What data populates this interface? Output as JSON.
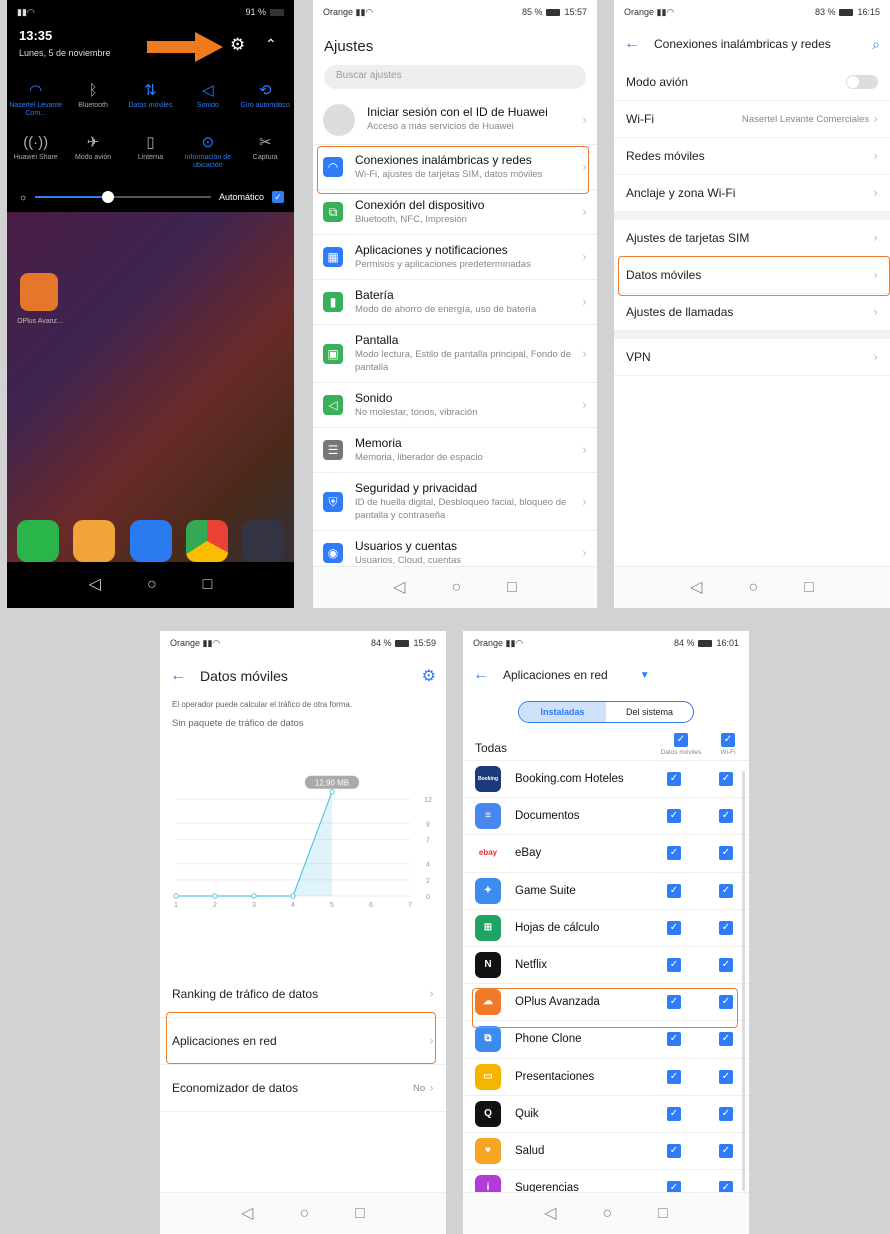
{
  "p1": {
    "status_right": "91 %",
    "time": "13:35",
    "date": "Lunes, 5 de noviembre",
    "tiles_row1": [
      {
        "icon": "wifi-icon",
        "glyph": "◠",
        "label": "Nasertel Levante Com...",
        "on": true
      },
      {
        "icon": "bluetooth-icon",
        "glyph": "ᛒ",
        "label": "Bluetooth",
        "on": false
      },
      {
        "icon": "mobile-data-icon",
        "glyph": "⇅",
        "label": "Datos móviles",
        "on": true
      },
      {
        "icon": "sound-icon",
        "glyph": "◁",
        "label": "Sonido",
        "on": true
      },
      {
        "icon": "auto-rotate-icon",
        "glyph": "⟲",
        "label": "Giro automático",
        "on": true
      }
    ],
    "tiles_row2": [
      {
        "icon": "huawei-share-icon",
        "glyph": "((·))",
        "label": "Huawei Share",
        "on": false
      },
      {
        "icon": "airplane-icon",
        "glyph": "✈",
        "label": "Modo avión",
        "on": false
      },
      {
        "icon": "flashlight-icon",
        "glyph": "▯",
        "label": "Linterna",
        "on": false
      },
      {
        "icon": "location-icon",
        "glyph": "⊙",
        "label": "Información de ubicación",
        "on": true
      },
      {
        "icon": "screenshot-icon",
        "glyph": "✂",
        "label": "Captura",
        "on": false
      }
    ],
    "brightness_label": "Automático",
    "app_label": "OPlus Avanz..."
  },
  "p2": {
    "carrier": "Orange",
    "status_right": "85 %",
    "clock": "15:57",
    "title": "Ajustes",
    "search_placeholder": "Buscar ajustes",
    "account": {
      "title": "Iniciar sesión con el ID de Huawei",
      "sub": "Acceso a más servicios de Huawei"
    },
    "items": [
      {
        "icon": "wireless-icon",
        "glyph": "◠",
        "color": "#2f7cf6",
        "title": "Conexiones inalámbricas y redes",
        "sub": "Wi-Fi, ajustes de tarjetas SIM, datos móviles"
      },
      {
        "icon": "device-connection-icon",
        "glyph": "⧉",
        "color": "#3ab05a",
        "title": "Conexión del dispositivo",
        "sub": "Bluetooth, NFC, Impresión"
      },
      {
        "icon": "apps-icon",
        "glyph": "▦",
        "color": "#2f7cf6",
        "title": "Aplicaciones y notificaciones",
        "sub": "Permisos y aplicaciones predeterminadas"
      },
      {
        "icon": "battery-icon",
        "glyph": "▮",
        "color": "#3ab05a",
        "title": "Batería",
        "sub": "Modo de ahorro de energía, uso de batería"
      },
      {
        "icon": "display-icon",
        "glyph": "▣",
        "color": "#3ab05a",
        "title": "Pantalla",
        "sub": "Modo lectura, Estilo de pantalla principal, Fondo de pantalla"
      },
      {
        "icon": "sound-icon",
        "glyph": "◁",
        "color": "#3ab05a",
        "title": "Sonido",
        "sub": "No molestar, tonos, vibración"
      },
      {
        "icon": "storage-icon",
        "glyph": "☰",
        "color": "#777",
        "title": "Memoria",
        "sub": "Memoria, liberador de espacio"
      },
      {
        "icon": "security-icon",
        "glyph": "⛨",
        "color": "#2f7cf6",
        "title": "Seguridad y privacidad",
        "sub": "ID de huella digital, Desbloqueo facial, bloqueo de pantalla y contraseña"
      },
      {
        "icon": "users-icon",
        "glyph": "◉",
        "color": "#2f7cf6",
        "title": "Usuarios y cuentas",
        "sub": "Usuarios, Cloud, cuentas"
      }
    ]
  },
  "p3": {
    "carrier": "Orange",
    "status_right": "83 %",
    "clock": "16:15",
    "title": "Conexiones inalámbricas y redes",
    "group1": [
      {
        "label": "Modo avión",
        "value": "",
        "toggle": true
      },
      {
        "label": "Wi-Fi",
        "value": "Nasertel Levante Comerciales",
        "toggle": false
      },
      {
        "label": "Redes móviles",
        "value": "",
        "toggle": false
      },
      {
        "label": "Anclaje y zona Wi-Fi",
        "value": "",
        "toggle": false
      }
    ],
    "group2": [
      {
        "label": "Ajustes de tarjetas SIM"
      },
      {
        "label": "Datos móviles"
      },
      {
        "label": "Ajustes de llamadas"
      }
    ],
    "group3": [
      {
        "label": "VPN"
      }
    ]
  },
  "p4": {
    "carrier": "Orange",
    "status_right": "84 %",
    "clock": "15:59",
    "title": "Datos móviles",
    "note": "El operador puede calcular el tráfico de otra forma.",
    "package": "Sin paquete de tráfico de datos",
    "rows": [
      {
        "label": "Ranking de tráfico de datos",
        "value": ""
      },
      {
        "label": "Aplicaciones en red",
        "value": ""
      },
      {
        "label": "Economizador de datos",
        "value": "No"
      }
    ]
  },
  "chart_data": {
    "type": "area",
    "x": [
      1,
      2,
      3,
      4,
      5,
      6,
      7
    ],
    "series": [
      {
        "values": [
          0,
          0,
          0,
          0,
          12.9,
          null,
          null
        ]
      }
    ],
    "yticks": [
      0,
      2,
      4,
      7,
      9,
      12
    ],
    "xticks": [
      1,
      2,
      3,
      4,
      5,
      6,
      7
    ],
    "ylim": [
      0,
      13
    ],
    "annotation": "12,90 MB",
    "color": "#5cc5e6"
  },
  "p5": {
    "carrier": "Orange",
    "status_right": "84 %",
    "clock": "16:01",
    "title": "Aplicaciones en red",
    "seg_installed": "Instaladas",
    "seg_system": "Del sistema",
    "all_label": "Todas",
    "col_data": "Datos móviles",
    "col_wifi": "Wi-Fi",
    "apps": [
      {
        "name": "Booking.com Hoteles",
        "icon": "booking-icon",
        "glyph": "Booking",
        "color": "#1a3a7a"
      },
      {
        "name": "Documentos",
        "icon": "docs-icon",
        "glyph": "≡",
        "color": "#4a86f0"
      },
      {
        "name": "eBay",
        "icon": "ebay-icon",
        "glyph": "ebay",
        "color": "#ffffff"
      },
      {
        "name": "Game Suite",
        "icon": "game-suite-icon",
        "glyph": "✦",
        "color": "#3c8cf0"
      },
      {
        "name": "Hojas de cálculo",
        "icon": "sheets-icon",
        "glyph": "⊞",
        "color": "#1ea362"
      },
      {
        "name": "Netflix",
        "icon": "netflix-icon",
        "glyph": "N",
        "color": "#111111"
      },
      {
        "name": "OPlus Avanzada",
        "icon": "oplus-icon",
        "glyph": "☁",
        "color": "#ef7a2a"
      },
      {
        "name": "Phone Clone",
        "icon": "phone-clone-icon",
        "glyph": "⧉",
        "color": "#3c8cf0"
      },
      {
        "name": "Presentaciones",
        "icon": "slides-icon",
        "glyph": "▭",
        "color": "#f4b400"
      },
      {
        "name": "Quik",
        "icon": "quik-icon",
        "glyph": "Q",
        "color": "#111111"
      },
      {
        "name": "Salud",
        "icon": "health-icon",
        "glyph": "♥",
        "color": "#f6a623"
      },
      {
        "name": "Sugerencias",
        "icon": "tips-icon",
        "glyph": "i",
        "color": "#b23ad6"
      }
    ]
  }
}
